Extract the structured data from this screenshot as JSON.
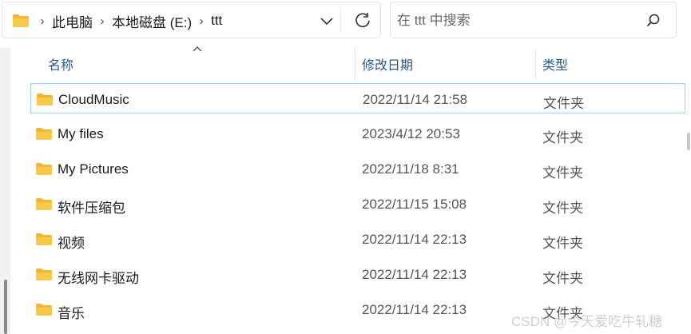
{
  "address_bar": {
    "breadcrumbs": [
      "此电脑",
      "本地磁盘 (E:)",
      "ttt"
    ]
  },
  "search": {
    "placeholder": "在 ttt 中搜索"
  },
  "columns": {
    "name": "名称",
    "date_modified": "修改日期",
    "type": "类型"
  },
  "files": [
    {
      "name": "CloudMusic",
      "date": "2022/11/14 21:58",
      "type": "文件夹",
      "selected": true
    },
    {
      "name": "My files",
      "date": "2023/4/12 20:53",
      "type": "文件夹"
    },
    {
      "name": "My Pictures",
      "date": "2022/11/18 8:31",
      "type": "文件夹"
    },
    {
      "name": "软件压缩包",
      "date": "2022/11/15 15:08",
      "type": "文件夹"
    },
    {
      "name": "视频",
      "date": "2022/11/14 22:13",
      "type": "文件夹"
    },
    {
      "name": "无线网卡驱动",
      "date": "2022/11/14 22:13",
      "type": "文件夹"
    },
    {
      "name": "音乐",
      "date": "2022/11/14 22:13",
      "type": "文件夹"
    }
  ],
  "watermark": "CSDN @今天爱吃牛轧糖",
  "icons": {
    "folder": "folder-icon",
    "chevron": "chevron-right-icon",
    "dropdown": "chevron-down-icon",
    "refresh": "refresh-icon",
    "search": "search-icon",
    "sort": "sort-up-icon"
  },
  "colors": {
    "folder": "#f7c948",
    "selection_border": "#99d1ff",
    "header_text": "#2b5a8a"
  }
}
